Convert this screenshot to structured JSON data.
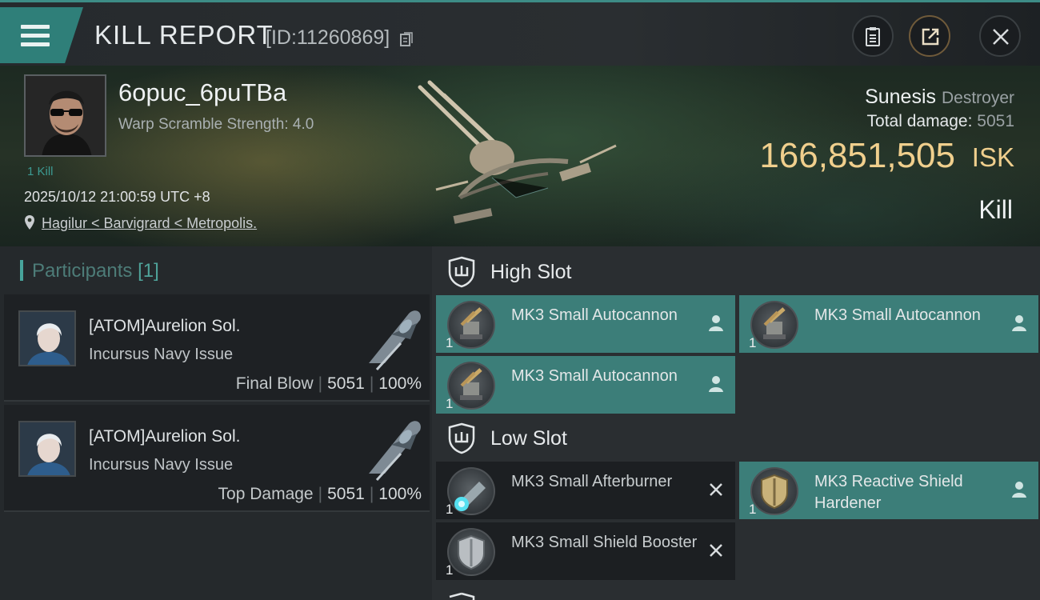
{
  "header": {
    "title": "KILL REPORT",
    "report_id": "[ID:11260869]"
  },
  "victim": {
    "pilot_name": "6opuc_6puTBa",
    "warp_scramble": "Warp Scramble Strength: 4.0",
    "kills": "1 Kill",
    "datetime": "2025/10/12 21:00:59 UTC +8",
    "location": "Hagilur < Barvigrard < Metropolis.",
    "ship_name": "Sunesis",
    "ship_class": "Destroyer",
    "total_damage_label": "Total damage:",
    "total_damage_value": "5051",
    "isk_value": "166,851,505",
    "isk_unit": "ISK",
    "result": "Kill"
  },
  "participants": {
    "title": "Participants",
    "count": "[1]",
    "rows": [
      {
        "name": "[ATOM]Aurelion Sol.",
        "ship": "Incursus Navy Issue",
        "label": "Final Blow",
        "damage": "5051",
        "percent": "100%"
      },
      {
        "name": "[ATOM]Aurelion Sol.",
        "ship": "Incursus Navy Issue",
        "label": "Top Damage",
        "damage": "5051",
        "percent": "100%"
      }
    ]
  },
  "fitting": {
    "high_slot_label": "High Slot",
    "low_slot_label": "Low Slot",
    "high_modules": [
      {
        "name": "MK3 Small Autocannon",
        "qty": "1",
        "state": "dropped"
      },
      {
        "name": "MK3 Small Autocannon",
        "qty": "1",
        "state": "dropped"
      },
      {
        "name": "MK3 Small Autocannon",
        "qty": "1",
        "state": "dropped"
      }
    ],
    "low_modules": [
      {
        "name": "MK3 Small Afterburner",
        "qty": "1",
        "state": "destroyed"
      },
      {
        "name": "MK3 Reactive Shield Hardener",
        "qty": "1",
        "state": "dropped"
      },
      {
        "name": "MK3 Small Shield Booster",
        "qty": "1",
        "state": "destroyed"
      }
    ]
  },
  "colors": {
    "accent_teal": "#3c7e79",
    "isk_gold": "#f0cf8d"
  },
  "icons": {
    "menu": "hamburger-icon",
    "clipboard": "clipboard-icon",
    "share": "share-icon",
    "close": "close-icon",
    "pin": "location-pin-icon",
    "slot": "shield-slot-icon",
    "pilot": "person-icon",
    "destroyed": "x-mark-icon"
  }
}
